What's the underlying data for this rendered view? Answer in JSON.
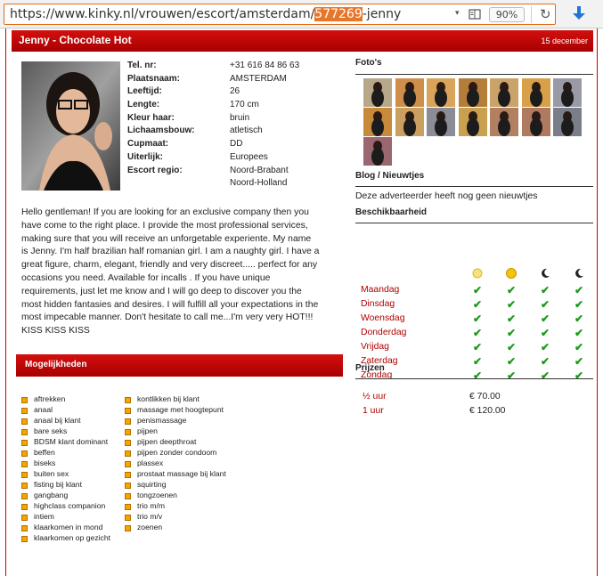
{
  "browser": {
    "url_prefix": "https://www.kinky.nl/vrouwen/escort/amsterdam/",
    "url_highlight": "577269",
    "url_suffix": "-jenny",
    "zoom": "90%",
    "dropdown_glyph": "▾",
    "reload_glyph": "↻"
  },
  "header": {
    "title": "Jenny - Chocolate Hot",
    "date": "15 december"
  },
  "profile": [
    {
      "key": "Tel. nr:",
      "value": "+31 616 84 86 63"
    },
    {
      "key": "Plaatsnaam:",
      "value": "AMSTERDAM"
    },
    {
      "key": "Leeftijd:",
      "value": "26"
    },
    {
      "key": "Lengte:",
      "value": "170 cm"
    },
    {
      "key": "Kleur haar:",
      "value": "bruin"
    },
    {
      "key": "Lichaamsbouw:",
      "value": "atletisch"
    },
    {
      "key": "Cupmaat:",
      "value": "DD"
    },
    {
      "key": "Uiterlijk:",
      "value": "Europees"
    },
    {
      "key": "Escort regio:",
      "value": "Noord-Brabant"
    },
    {
      "key": "",
      "value": "Noord-Holland"
    }
  ],
  "description": "Hello gentleman! If you are looking for an exclusive company then you have come to the right place. I provide the most professional services, making sure that you will receive an unforgetable experiente. My name is Jenny. I'm half brazilian half romanian girl. I am a naughty girl. I have a great figure, charm, elegant, friendly and very discreet..... perfect for any occasions you need. Available for incalls . If you have unique requirements, just let me know and I will go deep to discover you the most hidden fantasies and desires. I will fulfill all your expectations in the most impecable manner. Don't hesitate to call me...I'm very very HOT!!! KISS KISS KISS",
  "services": {
    "heading": "Mogelijkheden",
    "col1": [
      "aftrekken",
      "anaal",
      "anaal bij klant",
      "bare seks",
      "BDSM klant dominant",
      "beffen",
      "biseks",
      "buiten sex",
      "fisting bij klant",
      "gangbang",
      "highclass companion",
      "intiem",
      "klaarkomen in mond",
      "klaarkomen op gezicht"
    ],
    "col2": [
      "kontlikken bij klant",
      "massage met hoogtepunt",
      "penismassage",
      "pijpen",
      "pijpen deepthroat",
      "pijpen zonder condoom",
      "plassex",
      "prostaat massage bij klant",
      "squirting",
      "tongzoenen",
      "trio m/m",
      "trio m/v",
      "zoenen"
    ]
  },
  "photos": {
    "heading": "Foto's",
    "count": 15
  },
  "blog": {
    "heading": "Blog / Nieuwtjes",
    "text": "Deze adverteerder heeft nog geen nieuwtjes"
  },
  "availability": {
    "heading": "Beschikbaarheid",
    "columns": [
      "morning-sun-icon",
      "afternoon-sun-icon",
      "evening-moon-icon",
      "night-moon-icon"
    ],
    "days": [
      "Maandag",
      "Dinsdag",
      "Woensdag",
      "Donderdag",
      "Vrijdag",
      "Zaterdag",
      "Zondag"
    ],
    "check": "✔"
  },
  "prices": {
    "heading": "Prijzen",
    "rows": [
      {
        "label": "½  uur",
        "amount": "€ 70.00"
      },
      {
        "label": "1   uur",
        "amount": "€ 120.00"
      }
    ]
  },
  "colors": {
    "brand_red": "#c00000",
    "check_green": "#1a9a1a",
    "bullet_orange": "#f5a400"
  }
}
